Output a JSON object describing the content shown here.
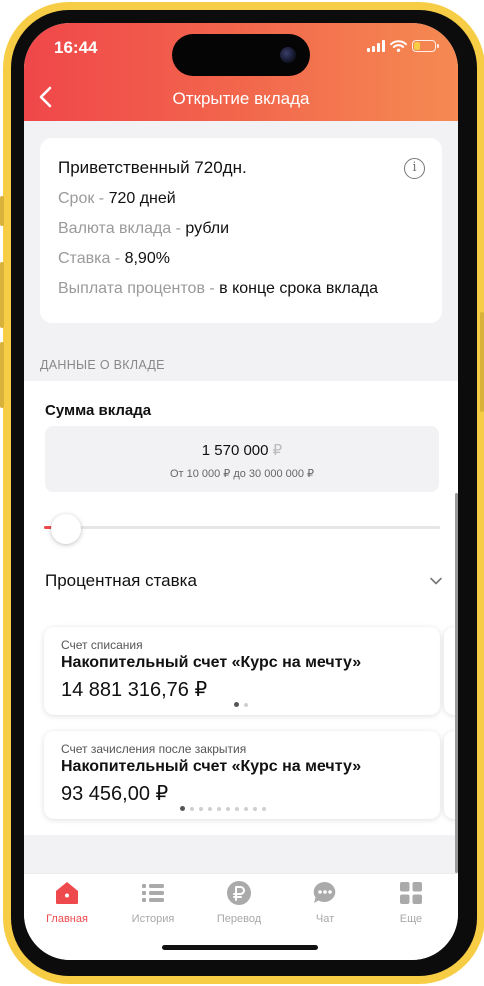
{
  "status_bar": {
    "time": "16:44"
  },
  "header": {
    "title": "Открытие вклада"
  },
  "deposit": {
    "title": "Приветственный 720дн.",
    "term_label": "Срок - ",
    "term_value": "720 дней",
    "currency_label": "Валюта вклада - ",
    "currency_value": "рубли",
    "rate_label": "Ставка - ",
    "rate_value": "8,90%",
    "payout_label": "Выплата процентов - ",
    "payout_value": "в конце срока вклада",
    "info_icon": "info-circle-icon"
  },
  "section": {
    "label": "ДАННЫЕ О ВКЛАДЕ"
  },
  "amount": {
    "label": "Сумма вклада",
    "value": "1 570 000",
    "currency": "₽",
    "range": "От 10 000 ₽ до 30 000 000 ₽",
    "slider_fraction": 0.052
  },
  "rate": {
    "label": "Процентная ставка",
    "icon": "chevron-down-icon"
  },
  "debit_account": {
    "label": "Счет списания",
    "name": "Накопительный счет «Курс на мечту»",
    "amount": "14 881 316,76 ₽",
    "page_count": 2,
    "active_page": 0
  },
  "credit_account": {
    "label": "Счет зачисления после закрытия",
    "name": "Накопительный счет «Курс на мечту»",
    "amount": "93 456,00 ₽",
    "page_count": 10,
    "active_page": 0
  },
  "tabs": [
    {
      "label": "Главная",
      "icon": "home-icon",
      "active": true
    },
    {
      "label": "История",
      "icon": "list-icon",
      "active": false
    },
    {
      "label": "Перевод",
      "icon": "ruble-icon",
      "active": false
    },
    {
      "label": "Чат",
      "icon": "chat-icon",
      "active": false
    },
    {
      "label": "Еще",
      "icon": "grid-icon",
      "active": false
    }
  ],
  "colors": {
    "accent": "#ee4a4d",
    "header_gradient_start": "#f0474a",
    "header_gradient_end": "#f58a52",
    "frame": "#f6cd45"
  }
}
